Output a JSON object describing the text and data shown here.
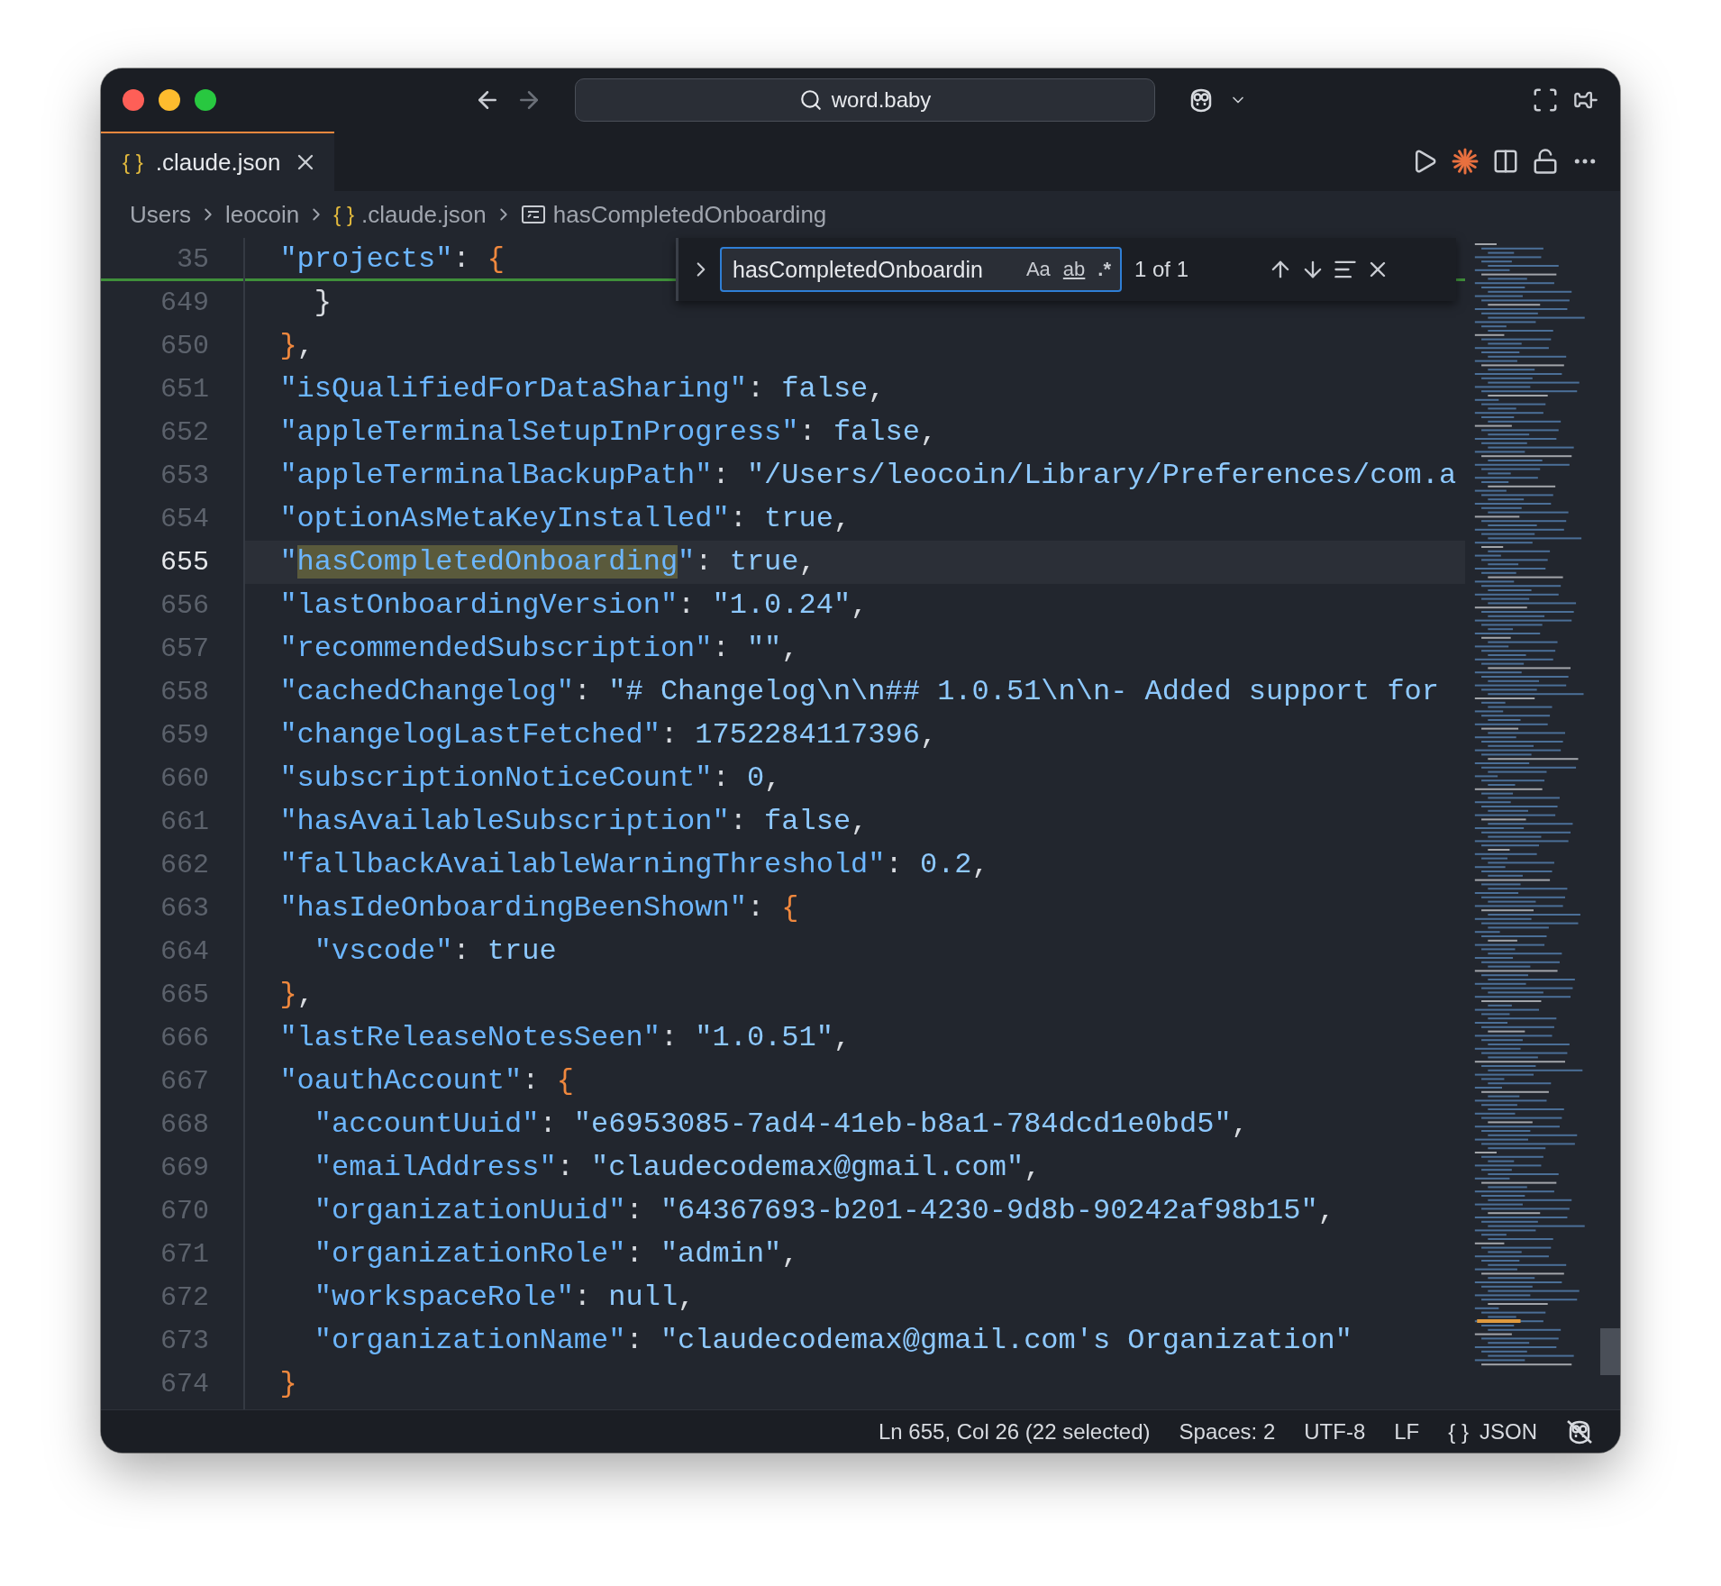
{
  "titlebar": {
    "search": "word.baby"
  },
  "tabs": [
    {
      "icon": "{ }",
      "label": ".claude.json",
      "selected": true
    }
  ],
  "breadcrumbs": [
    {
      "kind": "folder",
      "label": "Users"
    },
    {
      "kind": "folder",
      "label": "leocoin"
    },
    {
      "kind": "file",
      "icon": "{ }",
      "label": ".claude.json"
    },
    {
      "kind": "symbol",
      "label": "hasCompletedOnboarding"
    }
  ],
  "find": {
    "value": "hasCompletedOnboardin",
    "options": [
      {
        "kind": "case",
        "label": "Aa",
        "on": false
      },
      {
        "kind": "word",
        "label": "ab",
        "on": false
      },
      {
        "kind": "regex",
        "label": ".*",
        "on": false
      }
    ],
    "count": "1 of 1"
  },
  "lines": [
    {
      "number": "35",
      "sticky": true,
      "current": false,
      "tokens": [
        {
          "kind": "key",
          "text": "  \"projects\""
        },
        {
          "kind": "punct",
          "text": ": "
        },
        {
          "kind": "brace",
          "text": "{"
        }
      ]
    },
    {
      "number": "649",
      "sticky": false,
      "current": false,
      "tokens": [
        {
          "kind": "punct",
          "text": "    }"
        }
      ]
    },
    {
      "number": "650",
      "sticky": false,
      "current": false,
      "tokens": [
        {
          "kind": "brace",
          "text": "  }"
        },
        {
          "kind": "punct",
          "text": ","
        }
      ]
    },
    {
      "number": "651",
      "sticky": false,
      "current": false,
      "tokens": [
        {
          "kind": "key",
          "text": "  \"isQualifiedForDataSharing\""
        },
        {
          "kind": "punct",
          "text": ": "
        },
        {
          "kind": "value",
          "text": "false"
        },
        {
          "kind": "punct",
          "text": ","
        }
      ]
    },
    {
      "number": "652",
      "sticky": false,
      "current": false,
      "tokens": [
        {
          "kind": "key",
          "text": "  \"appleTerminalSetupInProgress\""
        },
        {
          "kind": "punct",
          "text": ": "
        },
        {
          "kind": "value",
          "text": "false"
        },
        {
          "kind": "punct",
          "text": ","
        }
      ]
    },
    {
      "number": "653",
      "sticky": false,
      "current": false,
      "tokens": [
        {
          "kind": "key",
          "text": "  \"appleTerminalBackupPath\""
        },
        {
          "kind": "punct",
          "text": ": "
        },
        {
          "kind": "value",
          "text": "\"/Users/leocoin/Library/Preferences/com.a"
        }
      ]
    },
    {
      "number": "654",
      "sticky": false,
      "current": false,
      "tokens": [
        {
          "kind": "key",
          "text": "  \"optionAsMetaKeyInstalled\""
        },
        {
          "kind": "punct",
          "text": ": "
        },
        {
          "kind": "value",
          "text": "true"
        },
        {
          "kind": "punct",
          "text": ","
        }
      ]
    },
    {
      "number": "655",
      "sticky": false,
      "current": true,
      "tokens": [
        {
          "kind": "key",
          "text": "  \""
        },
        {
          "kind": "match",
          "text": "hasCompletedOnboarding"
        },
        {
          "kind": "key",
          "text": "\""
        },
        {
          "kind": "punct",
          "text": ": "
        },
        {
          "kind": "value",
          "text": "true"
        },
        {
          "kind": "punct",
          "text": ","
        }
      ]
    },
    {
      "number": "656",
      "sticky": false,
      "current": false,
      "tokens": [
        {
          "kind": "key",
          "text": "  \"lastOnboardingVersion\""
        },
        {
          "kind": "punct",
          "text": ": "
        },
        {
          "kind": "value",
          "text": "\"1.0.24\""
        },
        {
          "kind": "punct",
          "text": ","
        }
      ]
    },
    {
      "number": "657",
      "sticky": false,
      "current": false,
      "tokens": [
        {
          "kind": "key",
          "text": "  \"recommendedSubscription\""
        },
        {
          "kind": "punct",
          "text": ": "
        },
        {
          "kind": "value",
          "text": "\"\""
        },
        {
          "kind": "punct",
          "text": ","
        }
      ]
    },
    {
      "number": "658",
      "sticky": false,
      "current": false,
      "tokens": [
        {
          "kind": "key",
          "text": "  \"cachedChangelog\""
        },
        {
          "kind": "punct",
          "text": ": "
        },
        {
          "kind": "value",
          "text": "\"# Changelog\\n\\n## 1.0.51\\n\\n- Added support for"
        }
      ]
    },
    {
      "number": "659",
      "sticky": false,
      "current": false,
      "tokens": [
        {
          "kind": "key",
          "text": "  \"changelogLastFetched\""
        },
        {
          "kind": "punct",
          "text": ": "
        },
        {
          "kind": "value",
          "text": "1752284117396"
        },
        {
          "kind": "punct",
          "text": ","
        }
      ]
    },
    {
      "number": "660",
      "sticky": false,
      "current": false,
      "tokens": [
        {
          "kind": "key",
          "text": "  \"subscriptionNoticeCount\""
        },
        {
          "kind": "punct",
          "text": ": "
        },
        {
          "kind": "value",
          "text": "0"
        },
        {
          "kind": "punct",
          "text": ","
        }
      ]
    },
    {
      "number": "661",
      "sticky": false,
      "current": false,
      "tokens": [
        {
          "kind": "key",
          "text": "  \"hasAvailableSubscription\""
        },
        {
          "kind": "punct",
          "text": ": "
        },
        {
          "kind": "value",
          "text": "false"
        },
        {
          "kind": "punct",
          "text": ","
        }
      ]
    },
    {
      "number": "662",
      "sticky": false,
      "current": false,
      "tokens": [
        {
          "kind": "key",
          "text": "  \"fallbackAvailableWarningThreshold\""
        },
        {
          "kind": "punct",
          "text": ": "
        },
        {
          "kind": "value",
          "text": "0.2"
        },
        {
          "kind": "punct",
          "text": ","
        }
      ]
    },
    {
      "number": "663",
      "sticky": false,
      "current": false,
      "tokens": [
        {
          "kind": "key",
          "text": "  \"hasIdeOnboardingBeenShown\""
        },
        {
          "kind": "punct",
          "text": ": "
        },
        {
          "kind": "brace",
          "text": "{"
        }
      ]
    },
    {
      "number": "664",
      "sticky": false,
      "current": false,
      "tokens": [
        {
          "kind": "key",
          "text": "    \"vscode\""
        },
        {
          "kind": "punct",
          "text": ": "
        },
        {
          "kind": "value",
          "text": "true"
        }
      ]
    },
    {
      "number": "665",
      "sticky": false,
      "current": false,
      "tokens": [
        {
          "kind": "brace",
          "text": "  }"
        },
        {
          "kind": "punct",
          "text": ","
        }
      ]
    },
    {
      "number": "666",
      "sticky": false,
      "current": false,
      "tokens": [
        {
          "kind": "key",
          "text": "  \"lastReleaseNotesSeen\""
        },
        {
          "kind": "punct",
          "text": ": "
        },
        {
          "kind": "value",
          "text": "\"1.0.51\""
        },
        {
          "kind": "punct",
          "text": ","
        }
      ]
    },
    {
      "number": "667",
      "sticky": false,
      "current": false,
      "tokens": [
        {
          "kind": "key",
          "text": "  \"oauthAccount\""
        },
        {
          "kind": "punct",
          "text": ": "
        },
        {
          "kind": "brace",
          "text": "{"
        }
      ]
    },
    {
      "number": "668",
      "sticky": false,
      "current": false,
      "tokens": [
        {
          "kind": "key",
          "text": "    \"accountUuid\""
        },
        {
          "kind": "punct",
          "text": ": "
        },
        {
          "kind": "value",
          "text": "\"e6953085-7ad4-41eb-b8a1-784dcd1e0bd5\""
        },
        {
          "kind": "punct",
          "text": ","
        }
      ]
    },
    {
      "number": "669",
      "sticky": false,
      "current": false,
      "tokens": [
        {
          "kind": "key",
          "text": "    \"emailAddress\""
        },
        {
          "kind": "punct",
          "text": ": "
        },
        {
          "kind": "value",
          "text": "\"claudecodemax@gmail.com\""
        },
        {
          "kind": "punct",
          "text": ","
        }
      ]
    },
    {
      "number": "670",
      "sticky": false,
      "current": false,
      "tokens": [
        {
          "kind": "key",
          "text": "    \"organizationUuid\""
        },
        {
          "kind": "punct",
          "text": ": "
        },
        {
          "kind": "value",
          "text": "\"64367693-b201-4230-9d8b-90242af98b15\""
        },
        {
          "kind": "punct",
          "text": ","
        }
      ]
    },
    {
      "number": "671",
      "sticky": false,
      "current": false,
      "tokens": [
        {
          "kind": "key",
          "text": "    \"organizationRole\""
        },
        {
          "kind": "punct",
          "text": ": "
        },
        {
          "kind": "value",
          "text": "\"admin\""
        },
        {
          "kind": "punct",
          "text": ","
        }
      ]
    },
    {
      "number": "672",
      "sticky": false,
      "current": false,
      "tokens": [
        {
          "kind": "key",
          "text": "    \"workspaceRole\""
        },
        {
          "kind": "punct",
          "text": ": "
        },
        {
          "kind": "value",
          "text": "null"
        },
        {
          "kind": "punct",
          "text": ","
        }
      ]
    },
    {
      "number": "673",
      "sticky": false,
      "current": false,
      "tokens": [
        {
          "kind": "key",
          "text": "    \"organizationName\""
        },
        {
          "kind": "punct",
          "text": ": "
        },
        {
          "kind": "value",
          "text": "\"claudecodemax@gmail.com's Organization\""
        }
      ]
    },
    {
      "number": "674",
      "sticky": false,
      "current": false,
      "tokens": [
        {
          "kind": "brace",
          "text": "  }"
        }
      ]
    }
  ],
  "status_bar": {
    "position": "Ln 655, Col 26 (22 selected)",
    "spaces": "Spaces: 2",
    "encoding": "UTF-8",
    "eol": "LF",
    "language_icon": "{ }",
    "language": "JSON"
  }
}
